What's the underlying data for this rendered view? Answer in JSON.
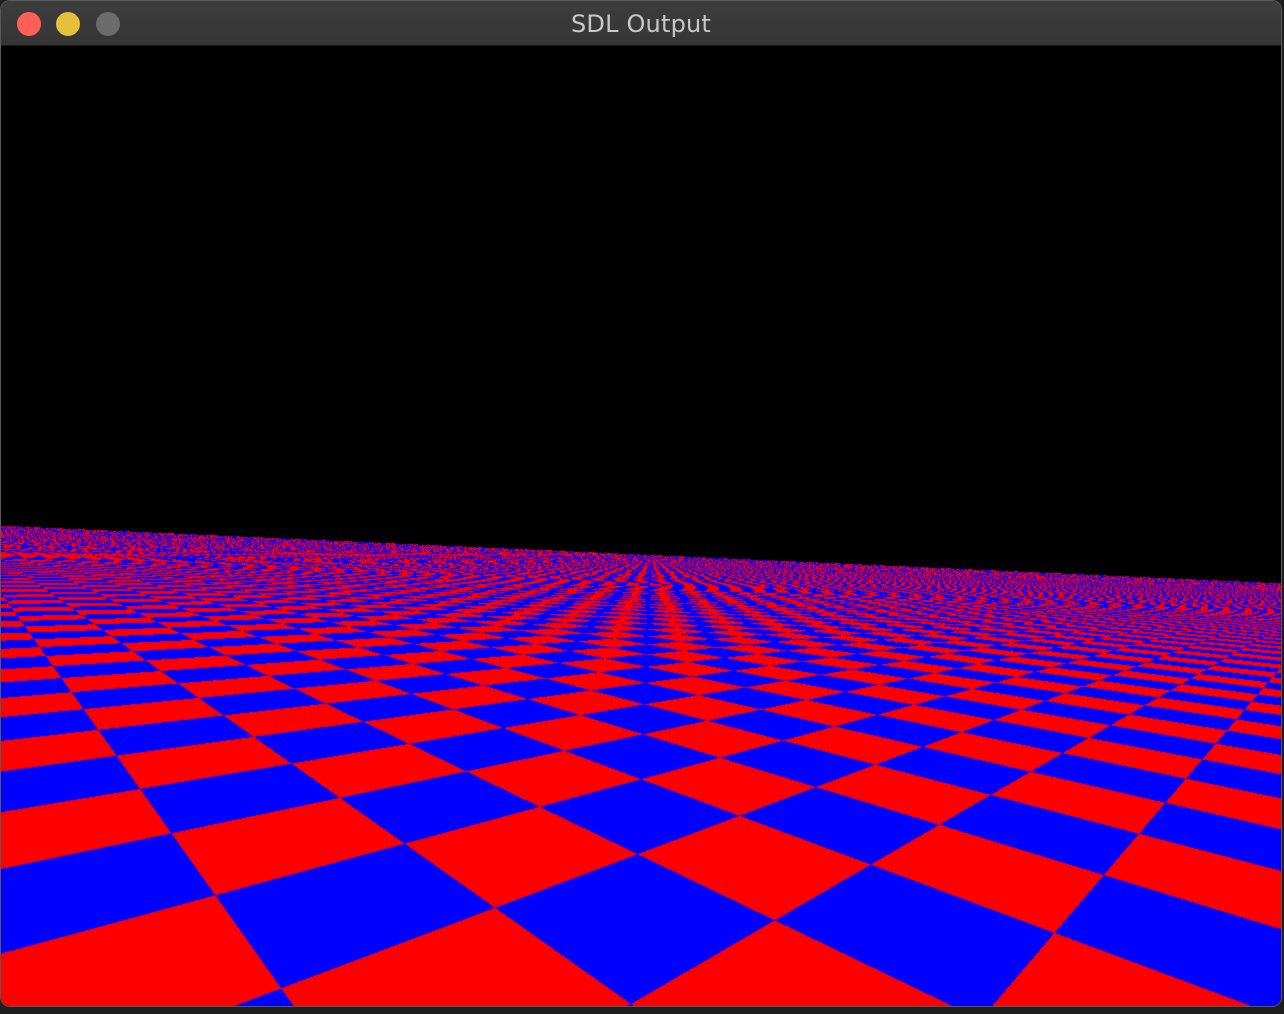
{
  "window": {
    "title": "SDL Output",
    "buttons": {
      "close": {
        "icon": "close-dot-icon",
        "color": "#ff5f57"
      },
      "minimize": {
        "icon": "minimize-dot-icon",
        "color": "#e6c03a"
      },
      "zoom": {
        "icon": "zoom-dot-icon",
        "color": "#6b6b6b"
      }
    }
  },
  "scene": {
    "background_color": "#000000",
    "checker_colors": [
      "#ff0000",
      "#0000ff"
    ],
    "description_type": "perspective-checkerboard-floor"
  }
}
